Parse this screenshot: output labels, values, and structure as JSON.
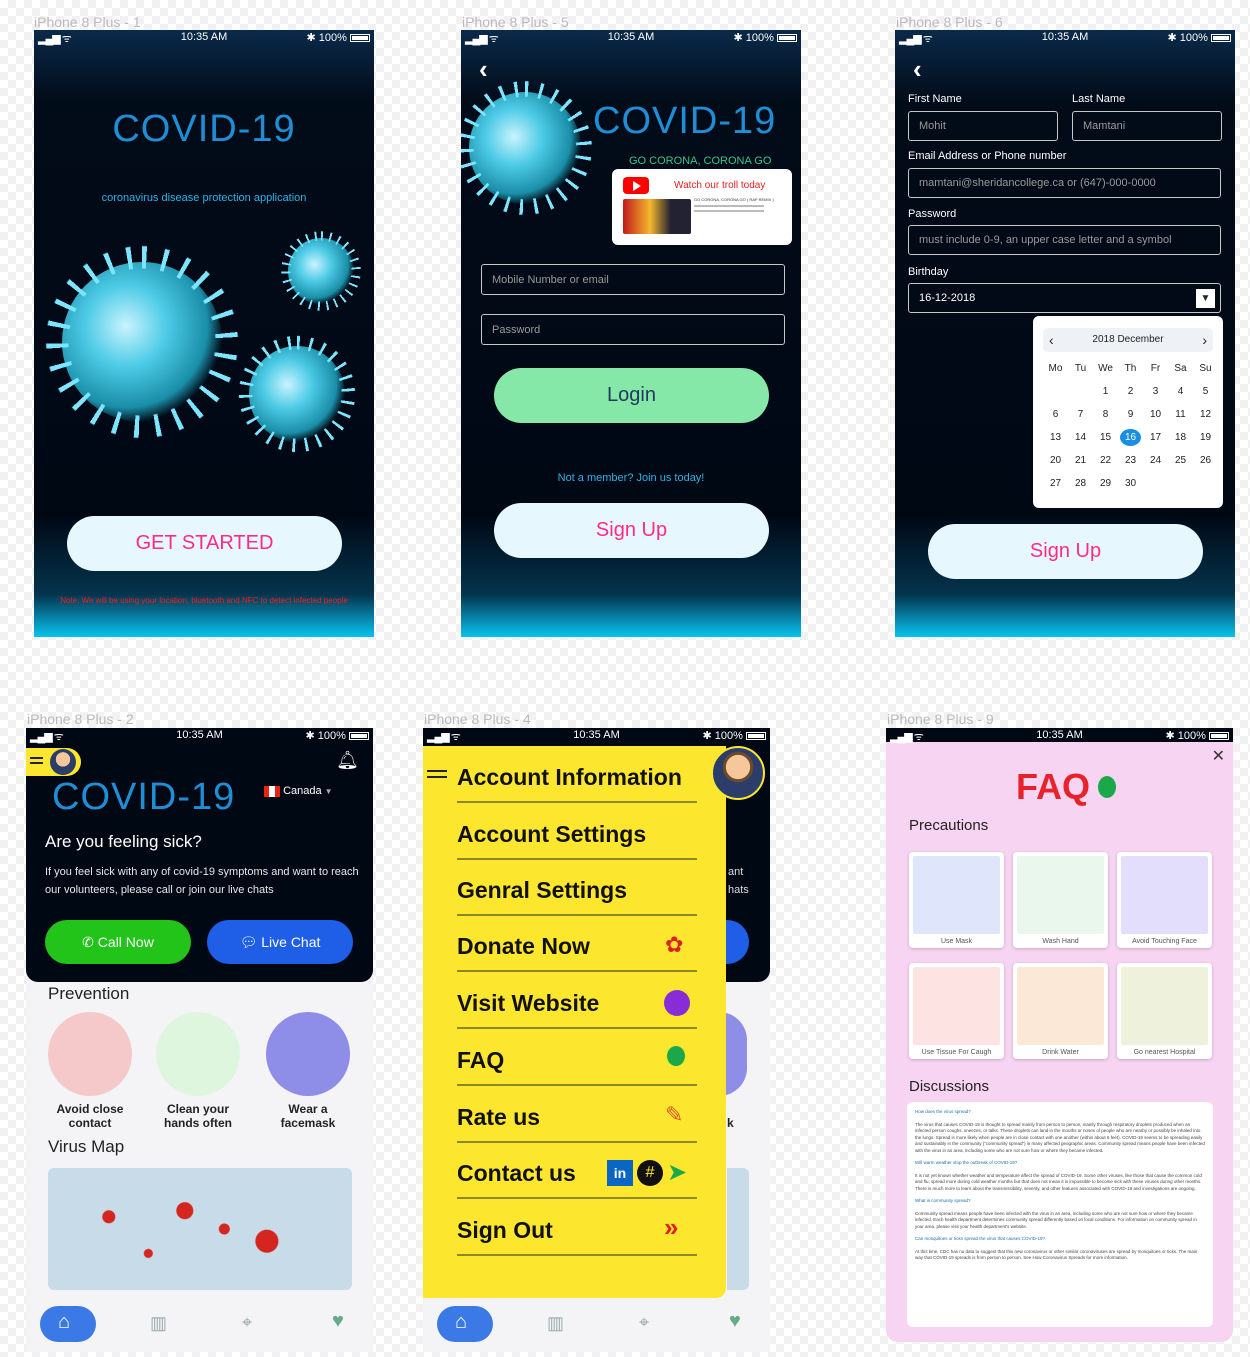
{
  "labels": [
    "iPhone 8 Plus - 1",
    "iPhone 8 Plus - 5",
    "iPhone 8 Plus - 6",
    "iPhone 8 Plus - 2",
    "iPhone 8 Plus - 4",
    "iPhone 8 Plus - 9"
  ],
  "status": {
    "time": "10:35 AM",
    "battery": "100%"
  },
  "screen1": {
    "title": "COVID-19",
    "subtitle": "coronavirus disease protection application",
    "cta": "GET STARTED",
    "note": "Note: We will be using your location, bluetooth and NFC to detect infected people"
  },
  "screen5": {
    "title": "COVID-19",
    "slogan": "GO CORONA, CORONA GO",
    "video_title": "Watch our troll today",
    "video_line1": "GO CORONA, CORONA GO ( RAP REMIX )",
    "email_placeholder": "Mobile Number or email",
    "password_placeholder": "Password",
    "login": "Login",
    "member_text": "Not a member? Join us today!",
    "signup": "Sign Up"
  },
  "screen6": {
    "first_name_label": "First Name",
    "last_name_label": "Last Name",
    "first_name": "Mohit",
    "last_name": "Mamtani",
    "email_label": "Email Address or Phone number",
    "email_placeholder": "mamtani@sheridancollege.ca or (647)-000-0000",
    "password_label": "Password",
    "password_placeholder": "must include 0-9, an upper case letter and a symbol",
    "birthday_label": "Birthday",
    "birthday": "16-12-2018",
    "calendar_header": "2018  December",
    "weekdays": [
      "Mo",
      "Tu",
      "We",
      "Th",
      "Fr",
      "Sa",
      "Su"
    ],
    "days": [
      "",
      "",
      "1",
      "2",
      "3",
      "4",
      "5",
      "6",
      "7",
      "8",
      "9",
      "10",
      "11",
      "12",
      "13",
      "14",
      "15",
      "16",
      "17",
      "18",
      "19",
      "20",
      "21",
      "22",
      "23",
      "24",
      "25",
      "26",
      "27",
      "28",
      "29",
      "30"
    ],
    "selected_day": "16",
    "signup": "Sign Up"
  },
  "screen2": {
    "title": "COVID-19",
    "country": "Canada",
    "question": "Are you feeling sick?",
    "desc": "If you feel sick with any of covid-19 symptoms and want to reach our volunteers, please call or join our live chats",
    "call": "Call Now",
    "chat": "Live Chat",
    "prevention": "Prevention",
    "prev_items": [
      "Avoid close contact",
      "Clean your hands often",
      "Wear a facemask"
    ],
    "virus_map": "Virus Map"
  },
  "screen4": {
    "menu": [
      "Account Information",
      "Account Settings",
      "Genral Settings",
      "Donate Now",
      "Visit Website",
      "FAQ",
      "Rate us",
      "Contact us",
      "Sign Out"
    ],
    "peek1": "ant",
    "peek2": "hats",
    "peek3": "k"
  },
  "screen9": {
    "title": "FAQ",
    "precautions": "Precautions",
    "cards": [
      "Use Mask",
      "Wash Hand",
      "Avoid Touching Face",
      "Use Tissue For Caugh",
      "Drink Water",
      "Go nearest Hospital"
    ],
    "discussions": "Discussions",
    "qa": [
      {
        "q": "How does the virus spread?",
        "a": "The virus that causes COVID-19 is thought to spread mainly from person to person, mainly through respiratory droplets produced when an infected person coughs, sneezes, or talks. These droplets can land in the mouths or noses of people who are nearby or possibly be inhaled into the lungs. Spread is more likely when people are in close contact with one another (within about 6 feet). COVID-19 seems to be spreading easily and sustainably in the community (“community spread”) in many affected geographic areas. Community spread means people have been infected with the virus in an area, including some who are not sure how or where they became infected."
      },
      {
        "q": "Will warm weather stop the outbreak of COVID-19?",
        "a": "It is not yet known whether weather and temperature affect the spread of COVID-19. Some other viruses, like those that cause the common cold and flu, spread more during cold weather months but that does not mean it is impossible to become sick with these viruses during other months. There is much more to learn about the transmissibility, severity, and other features associated with COVID-19 and investigations are ongoing."
      },
      {
        "q": "What is community spread?",
        "a": "Community spread means people have been infected with the virus in an area, including some who are not sure how or where they became infected. Each health department determines community spread differently based on local conditions. For information on community spread in your area, please visit your health department's website."
      },
      {
        "q": "Can mosquitoes or ticks spread the virus that causes COVID-19?",
        "a": "At this time, CDC has no data to suggest that this new coronavirus or other similar coronaviruses are spread by mosquitoes or ticks. The main way that COVID-19 spreads is from person to person. See How Coronavirus Spreads for more information."
      }
    ]
  },
  "colors": {
    "accent_blue": "#1e8fd6",
    "pink": "#ff2a8a",
    "mint": "#86e8a8",
    "yellow": "#fde72e",
    "faq_bg": "#f7d4f1",
    "faq_red": "#e8222a",
    "call_green": "#22c41a",
    "chat_blue": "#1f5fe8"
  }
}
